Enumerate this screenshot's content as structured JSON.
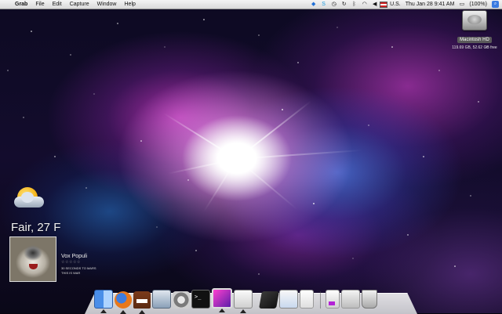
{
  "menubar": {
    "apple_glyph": "",
    "app_name": "Grab",
    "menus": [
      "File",
      "Edit",
      "Capture",
      "Window",
      "Help"
    ],
    "input_source": "U.S.",
    "clock": "Thu Jan 28  9:41 AM",
    "battery": "(100%)",
    "status_icons": [
      "dropbox-icon",
      "skype-icon",
      "timemachine-icon",
      "sync-icon",
      "bluetooth-icon",
      "wifi-icon",
      "volume-icon",
      "flag-icon",
      "battery-icon",
      "spotlight-icon"
    ]
  },
  "desktop": {
    "hard_drive": {
      "name": "Macintosh HD",
      "info": "119.69 GB, 52.62 GB free"
    }
  },
  "weather_widget": {
    "condition_icon": "partly-cloudy-sun-icon",
    "text": "Fair, 27 F"
  },
  "now_playing": {
    "artist": "Vox Populi",
    "rating": "☆☆☆☆☆",
    "album": "30 SECONDS TO MARS",
    "title": "THIS IS WAR"
  },
  "dock": {
    "items": [
      {
        "name": "finder",
        "running": true
      },
      {
        "name": "firefox",
        "running": true
      },
      {
        "name": "domo",
        "running": true
      },
      {
        "name": "itunes",
        "running": false
      },
      {
        "name": "system-preferences",
        "running": false
      },
      {
        "name": "terminal",
        "running": false
      },
      {
        "name": "photo-booth",
        "running": true
      },
      {
        "name": "grab",
        "running": true
      },
      {
        "name": "photoshop",
        "running": false
      },
      {
        "name": "preview",
        "running": false
      },
      {
        "name": "textedit",
        "running": false
      },
      {
        "name": "documents-stack",
        "running": false
      },
      {
        "name": "downloads-stack",
        "running": false
      },
      {
        "name": "trash",
        "running": false
      }
    ]
  }
}
